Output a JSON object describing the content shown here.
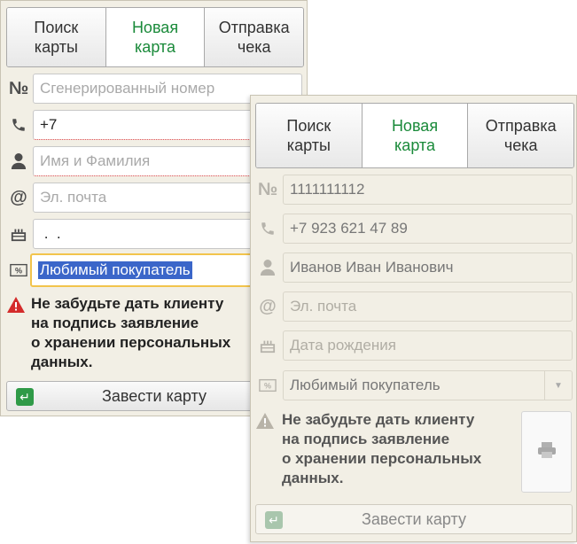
{
  "back": {
    "tabs": [
      "Поиск\nкарты",
      "Новая\nкарта",
      "Отправка\nчека"
    ],
    "fields": {
      "number_placeholder": "Сгенерированный номер",
      "phone_value": "+7",
      "name_placeholder": "Имя и Фамилия",
      "email_placeholder": "Эл. почта",
      "birthday_value": " .  .",
      "type_value": "Любимый покупатель"
    },
    "warning": "Не забудьте дать клиенту\nна подпись заявление\nо хранении персональных\nданных.",
    "submit_label": "Завести карту"
  },
  "front": {
    "tabs": [
      "Поиск\nкарты",
      "Новая\nкарта",
      "Отправка\nчека"
    ],
    "fields": {
      "number_value": "1111111112",
      "phone_value": "+7 923 621 47 89",
      "name_value": "Иванов Иван Иванович",
      "email_placeholder": "Эл. почта",
      "birthday_placeholder": "Дата рождения",
      "type_value": "Любимый покупатель"
    },
    "warning": "Не забудьте дать клиенту\nна подпись заявление\nо хранении персональных\nданных.",
    "submit_label": "Завести карту"
  },
  "icons": {
    "number": "numero-icon",
    "phone": "phone-icon",
    "person": "person-icon",
    "email": "at-icon",
    "birthday": "cake-icon",
    "discount": "percent-tag-icon",
    "warning": "warning-icon",
    "enter": "enter-icon",
    "print": "printer-icon"
  },
  "colors": {
    "active_tab": "#1a8a3a",
    "selection": "#3b66c9",
    "focus_border": "#f2c44c",
    "warning": "#d42b2b"
  }
}
